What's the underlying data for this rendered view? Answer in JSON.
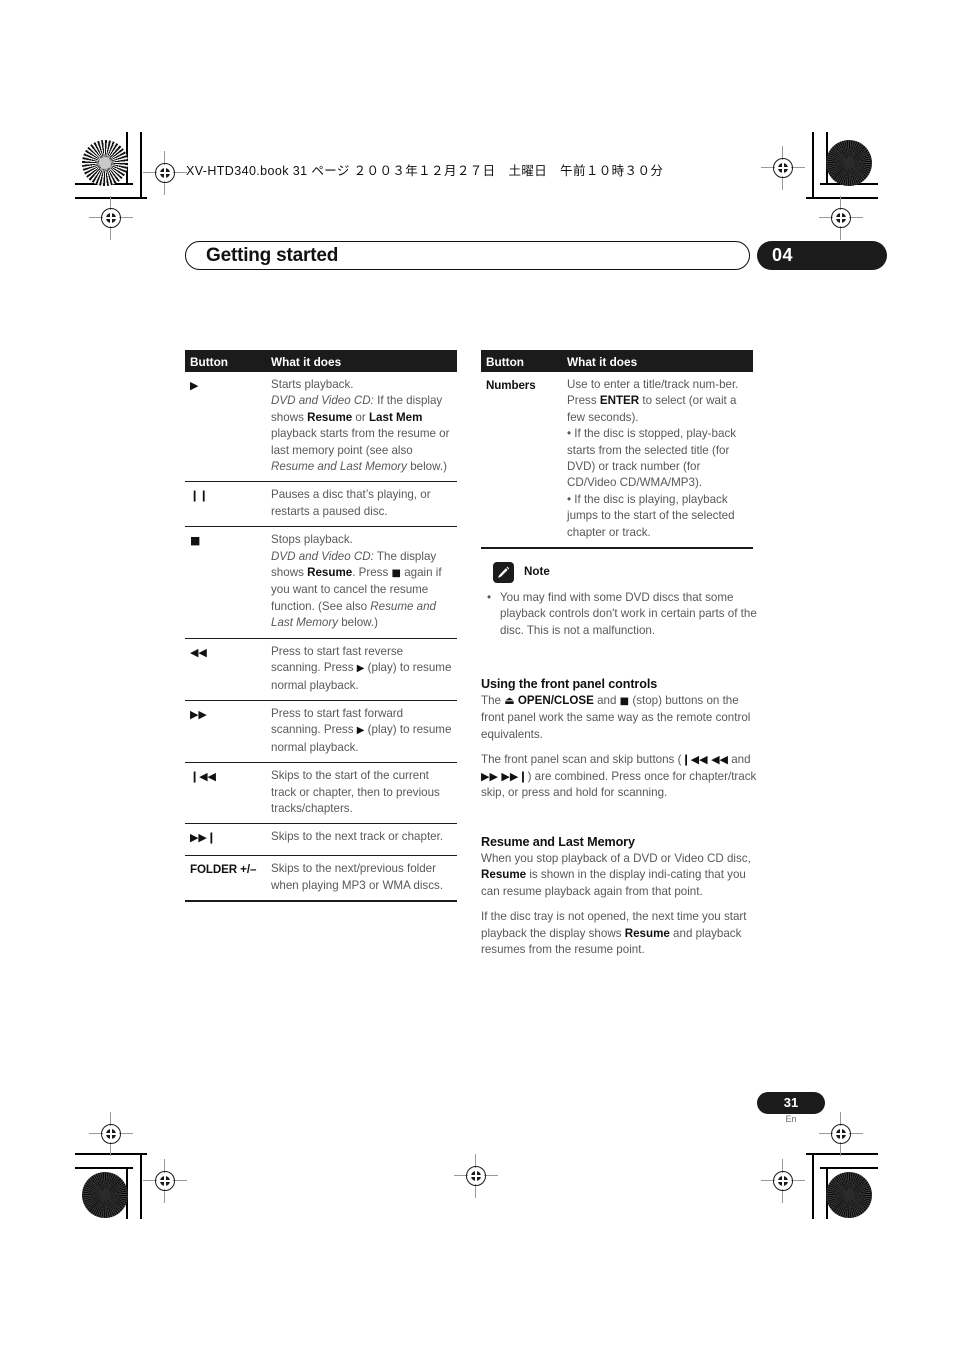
{
  "print_marks": {
    "file_header": "XV-HTD340.book  31 ページ  ２００３年１２月２７日　土曜日　午前１０時３０分"
  },
  "header": {
    "title": "Getting started",
    "chapter_number": "04"
  },
  "left_table": {
    "columns": [
      "Button",
      "What it does"
    ],
    "rows": [
      {
        "button_icon": "play-icon",
        "button_glyph": "▶",
        "desc_parts": [
          {
            "t": "Starts playback.",
            "s": "normal"
          },
          {
            "t": "BREAK"
          },
          {
            "t": "DVD and Video CD:",
            "s": "italic"
          },
          {
            "t": " If the display shows ",
            "s": "normal"
          },
          {
            "t": "Resume",
            "s": "bold"
          },
          {
            "t": " or ",
            "s": "normal"
          },
          {
            "t": "Last Mem",
            "s": "bold"
          },
          {
            "t": " playback starts from the resume or last memory point (see also ",
            "s": "normal"
          },
          {
            "t": "Resume and Last Memory",
            "s": "italic"
          },
          {
            "t": " below.)",
            "s": "normal"
          }
        ]
      },
      {
        "button_icon": "pause-icon",
        "button_glyph": "❙❙",
        "desc_parts": [
          {
            "t": "Pauses a disc that’s playing, or restarts a paused disc.",
            "s": "normal"
          }
        ]
      },
      {
        "button_icon": "stop-icon",
        "button_glyph": "■",
        "desc_parts": [
          {
            "t": "Stops playback.",
            "s": "normal"
          },
          {
            "t": "BREAK"
          },
          {
            "t": "DVD and Video CD:",
            "s": "italic"
          },
          {
            "t": " The display shows ",
            "s": "normal"
          },
          {
            "t": "Resume",
            "s": "bold"
          },
          {
            "t": ". Press ",
            "s": "normal"
          },
          {
            "t": "■",
            "s": "glyph"
          },
          {
            "t": " again if you want to cancel the resume function. (See also ",
            "s": "normal"
          },
          {
            "t": "Resume and Last Memory",
            "s": "italic"
          },
          {
            "t": " below.)",
            "s": "normal"
          }
        ]
      },
      {
        "button_icon": "fast-reverse-icon",
        "button_glyph": "◀◀",
        "desc_parts": [
          {
            "t": "Press to start fast reverse scanning. Press ",
            "s": "normal"
          },
          {
            "t": "▶",
            "s": "glyph"
          },
          {
            "t": " (play) to resume normal playback.",
            "s": "normal"
          }
        ]
      },
      {
        "button_icon": "fast-forward-icon",
        "button_glyph": "▶▶",
        "desc_parts": [
          {
            "t": "Press to start fast forward scanning. Press ",
            "s": "normal"
          },
          {
            "t": "▶",
            "s": "glyph"
          },
          {
            "t": " (play) to resume normal playback.",
            "s": "normal"
          }
        ]
      },
      {
        "button_icon": "previous-track-icon",
        "button_glyph": "❙◀◀",
        "desc_parts": [
          {
            "t": "Skips to the start of the current track or chapter, then to previous tracks/chapters.",
            "s": "normal"
          }
        ]
      },
      {
        "button_icon": "next-track-icon",
        "button_glyph": "▶▶❙",
        "desc_parts": [
          {
            "t": "Skips to the next track or chapter.",
            "s": "normal"
          }
        ]
      },
      {
        "button_icon": "folder-button",
        "button_glyph": "FOLDER +/–",
        "desc_parts": [
          {
            "t": "Skips to the next/previous folder when playing MP3 or WMA discs.",
            "s": "normal"
          }
        ]
      }
    ]
  },
  "right_table": {
    "columns": [
      "Button",
      "What it does"
    ],
    "rows": [
      {
        "button_icon": "numbers-button",
        "button_glyph": "Numbers",
        "desc_parts": [
          {
            "t": "Use to enter a title/track num-ber. Press ",
            "s": "normal"
          },
          {
            "t": "ENTER",
            "s": "bold"
          },
          {
            "t": " to select (or wait a few seconds).",
            "s": "normal"
          },
          {
            "t": "BREAK"
          },
          {
            "t": "• If the disc is stopped, play-back starts from the selected title (for DVD) or track number (for CD/Video CD/WMA/MP3).",
            "s": "normal"
          },
          {
            "t": "BREAK"
          },
          {
            "t": "• If the disc is playing, playback jumps to the start of the selected chapter or track.",
            "s": "normal"
          }
        ]
      }
    ]
  },
  "note": {
    "icon": "pencil-icon",
    "label": "Note",
    "bullet": "•",
    "text": "You may find with some DVD discs that some playback controls don't work in certain parts of the disc. This is not a malfunction."
  },
  "section_front_panel": {
    "heading": "Using the front panel controls",
    "para1_parts": [
      {
        "t": "The ",
        "s": "normal"
      },
      {
        "t": "⏏",
        "s": "glyph-bold"
      },
      {
        "t": " ",
        "s": "normal"
      },
      {
        "t": "OPEN/CLOSE",
        "s": "bold"
      },
      {
        "t": " and ",
        "s": "normal"
      },
      {
        "t": "■",
        "s": "glyph"
      },
      {
        "t": " (stop) buttons on the front panel work the same way as the remote control equivalents.",
        "s": "normal"
      }
    ],
    "para2_parts": [
      {
        "t": "The front panel scan and skip buttons (",
        "s": "normal"
      },
      {
        "t": "❙◀◀ ◀◀",
        "s": "glyph-bold"
      },
      {
        "t": " and ",
        "s": "normal"
      },
      {
        "t": "▶▶ ▶▶❙",
        "s": "glyph-bold"
      },
      {
        "t": ") are combined. Press once for chapter/track skip, or press and hold for scanning.",
        "s": "normal"
      }
    ]
  },
  "section_resume": {
    "heading": "Resume and Last Memory",
    "para1_parts": [
      {
        "t": "When you stop playback of a DVD or Video CD disc, ",
        "s": "normal"
      },
      {
        "t": "Resume",
        "s": "bold"
      },
      {
        "t": " is shown in the display indi-cating that you can resume playback again from that point.",
        "s": "normal"
      }
    ],
    "para2_parts": [
      {
        "t": "If the disc tray is not opened, the next time you start playback the display shows ",
        "s": "normal"
      },
      {
        "t": "Resume",
        "s": "bold"
      },
      {
        "t": " and playback resumes from the resume point.",
        "s": "normal"
      }
    ]
  },
  "footer": {
    "page_number": "31",
    "language": "En"
  },
  "colors": {
    "ink": "#1b1b1b",
    "body_text": "#58595b",
    "accent_black": "#000000"
  }
}
